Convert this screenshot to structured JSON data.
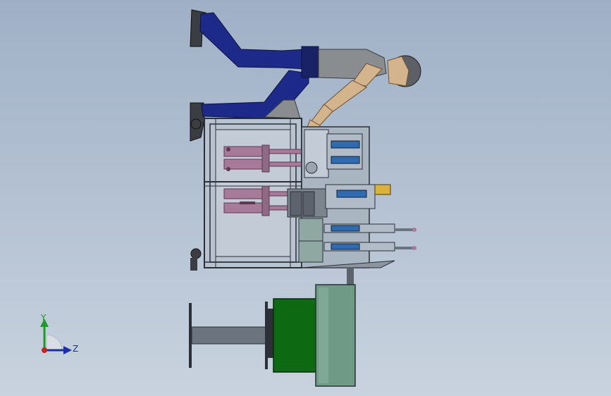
{
  "viewport": {
    "background_top": "#9fb0c6",
    "background_bottom": "#c9d3df"
  },
  "triad": {
    "y_label": "Y",
    "z_label": "Z",
    "y_color": "#1f9a2a",
    "z_color": "#1b2fa8",
    "origin_color": "#c8231c"
  },
  "model_colors": {
    "frame": "#2b3038",
    "pants": "#1e2a8a",
    "shirt": "#8a8d90",
    "skin": "#d3b48c",
    "cylinder": "#a87a9a",
    "motor_green": "#0e6a12",
    "fan_housing": "#6f9a86",
    "shaft": "#6c7480"
  },
  "icons": {
    "triad": "reference-triad-icon",
    "operator": "mannequin-icon"
  }
}
